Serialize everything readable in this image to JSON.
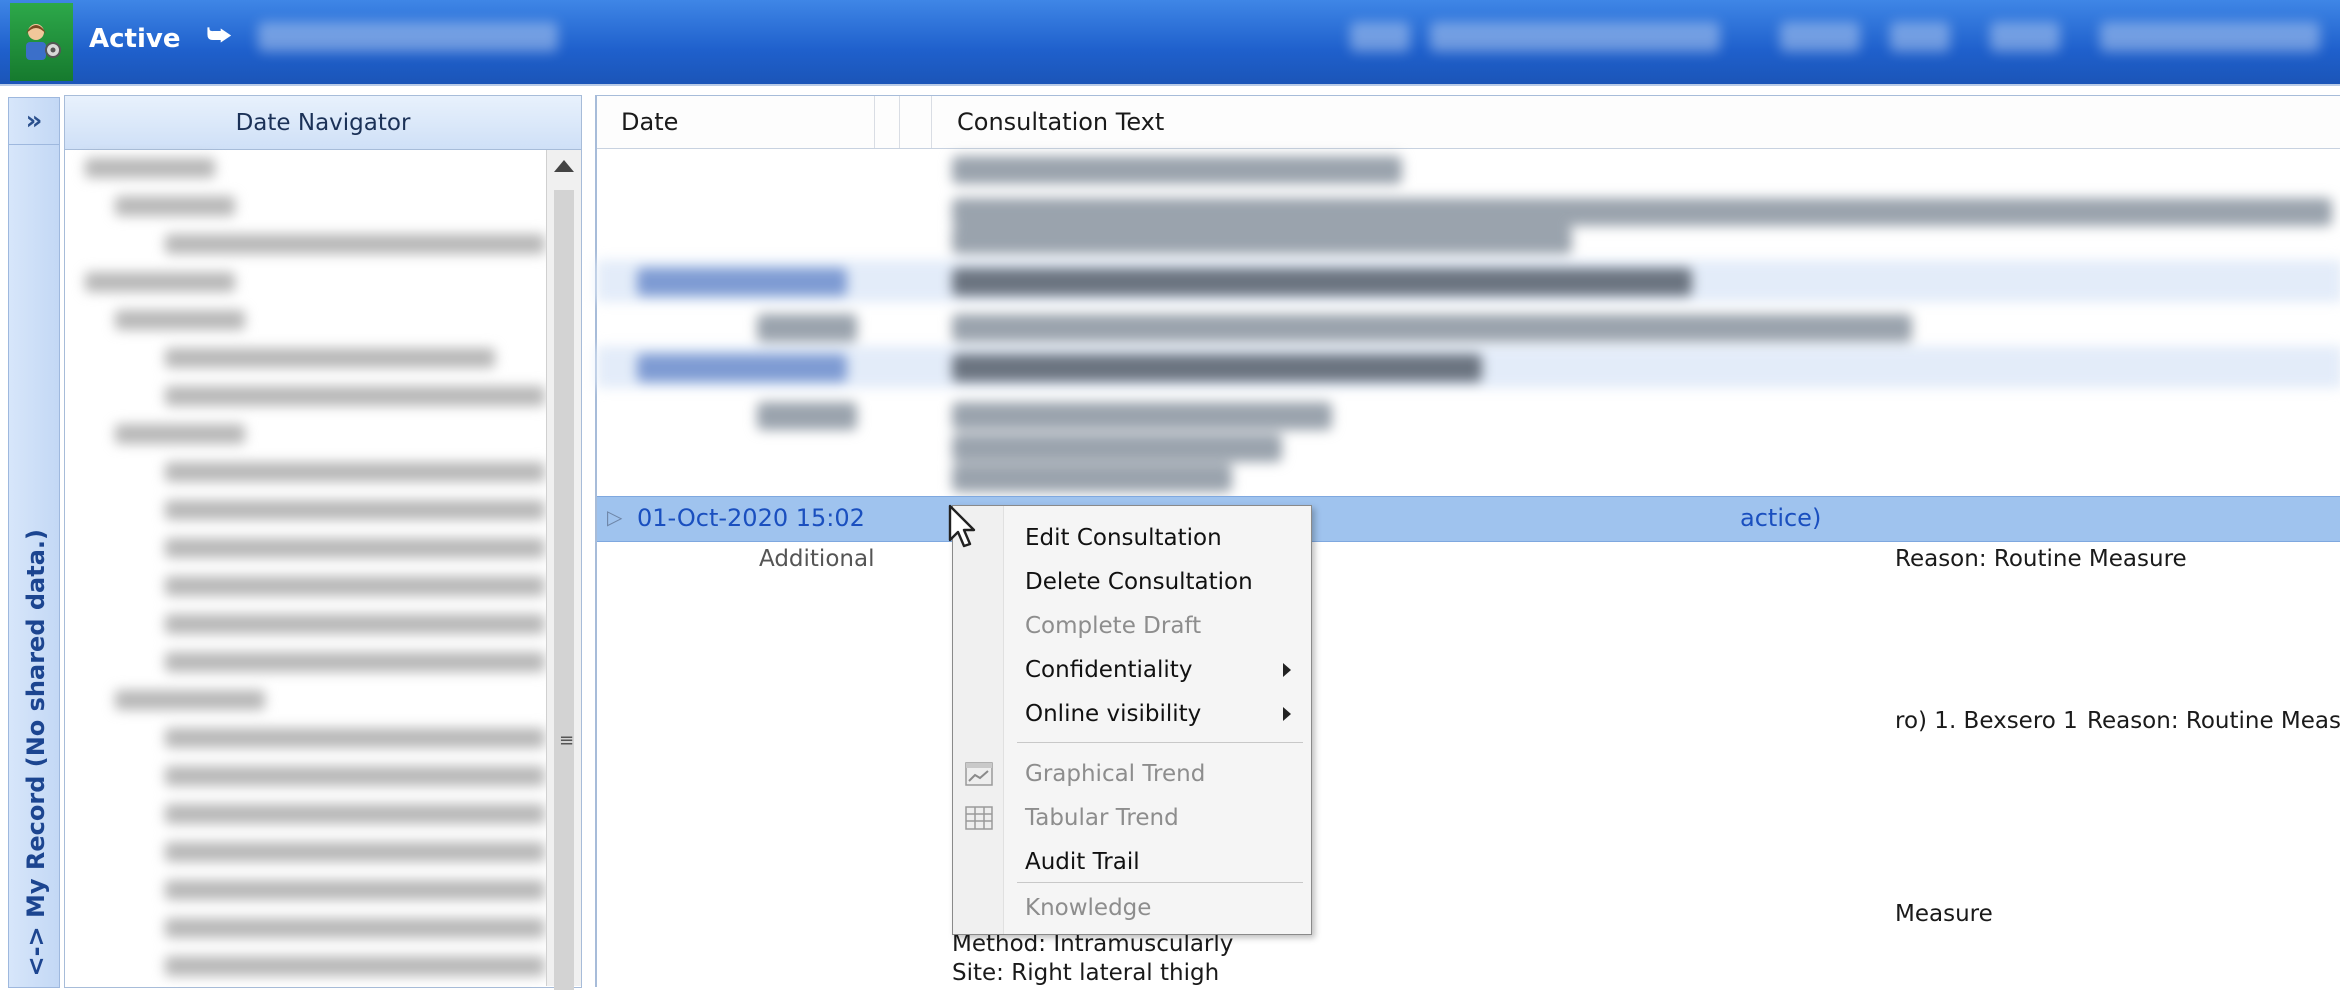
{
  "topbar": {
    "status_label": "Active"
  },
  "left_strip": {
    "vertical_label": "<-> My Record (No shared data.)"
  },
  "date_navigator": {
    "title": "Date Navigator"
  },
  "grid": {
    "columns": [
      "Date",
      "",
      "",
      "Consultation Text"
    ],
    "selected_row": {
      "date": "01-Oct-2020 15:02",
      "text_fragment": "actice)"
    },
    "additional_label": "Additional",
    "lines": [
      "Reason: Routine Measure",
      "ro) 1. Bexsero 1",
      "Reason: Routine Measure",
      "Measure",
      "Method: Intramuscularly",
      "Site: Right lateral thigh"
    ]
  },
  "context_menu": {
    "items": [
      {
        "label": "Edit Consultation",
        "enabled": true
      },
      {
        "label": "Delete Consultation",
        "enabled": true
      },
      {
        "label": "Complete Draft",
        "enabled": false
      },
      {
        "label": "Confidentiality",
        "enabled": true,
        "submenu": true
      },
      {
        "label": "Online visibility",
        "enabled": true,
        "submenu": true
      },
      {
        "label": "Graphical Trend",
        "enabled": false,
        "icon": "graph-icon"
      },
      {
        "label": "Tabular Trend",
        "enabled": false,
        "icon": "table-icon"
      },
      {
        "label": "Audit Trail",
        "enabled": true
      },
      {
        "label": "Knowledge",
        "enabled": false
      }
    ]
  },
  "colors": {
    "topbar": "#1f60cc",
    "selected_row": "#9fc3ee",
    "link_blue": "#1a4fbf",
    "user_tile": "#2da84a"
  }
}
